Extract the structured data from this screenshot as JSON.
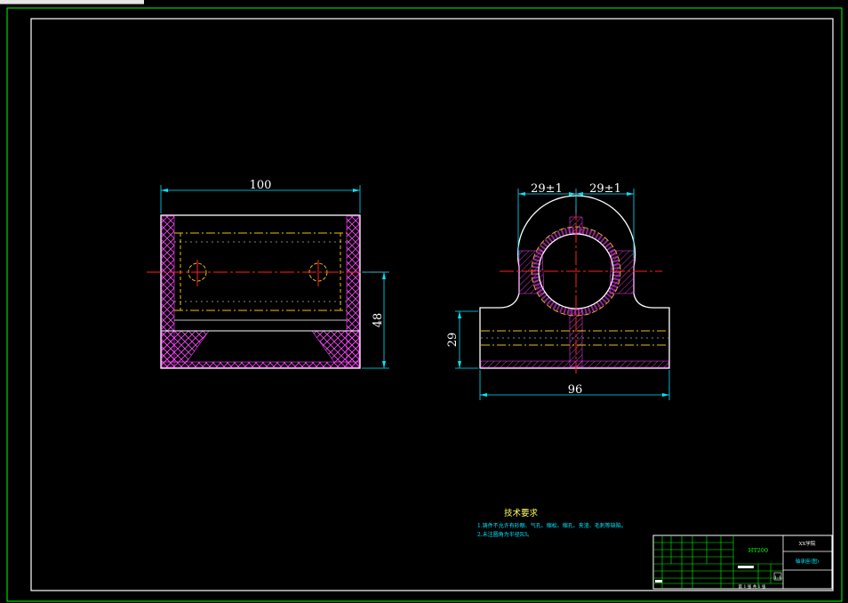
{
  "dimensions": {
    "front_width": "100",
    "front_height": "48",
    "side_half_left": "29±1",
    "side_half_right": "29±1",
    "side_height": "29",
    "side_width": "96"
  },
  "notes": {
    "title": "技术要求",
    "line1": "1.铸件不允许有砂眼、气孔、缩松、缩孔、夹渣、毛刺等缺陷。",
    "line2": "2.未注圆角为半径R3。"
  },
  "title_block": {
    "drawing_no": "HT200",
    "school": "XX学院",
    "part_name": "轴承座(图)",
    "scale": "1:1",
    "sheet": "第 1 张  共 1 张"
  },
  "colors": {
    "frame": "#00ff00",
    "outline": "#ffffff",
    "dimension": "#00e5ff",
    "center": "#ff2020",
    "hidden": "#f0c000",
    "hatch": "#ff44ff"
  }
}
